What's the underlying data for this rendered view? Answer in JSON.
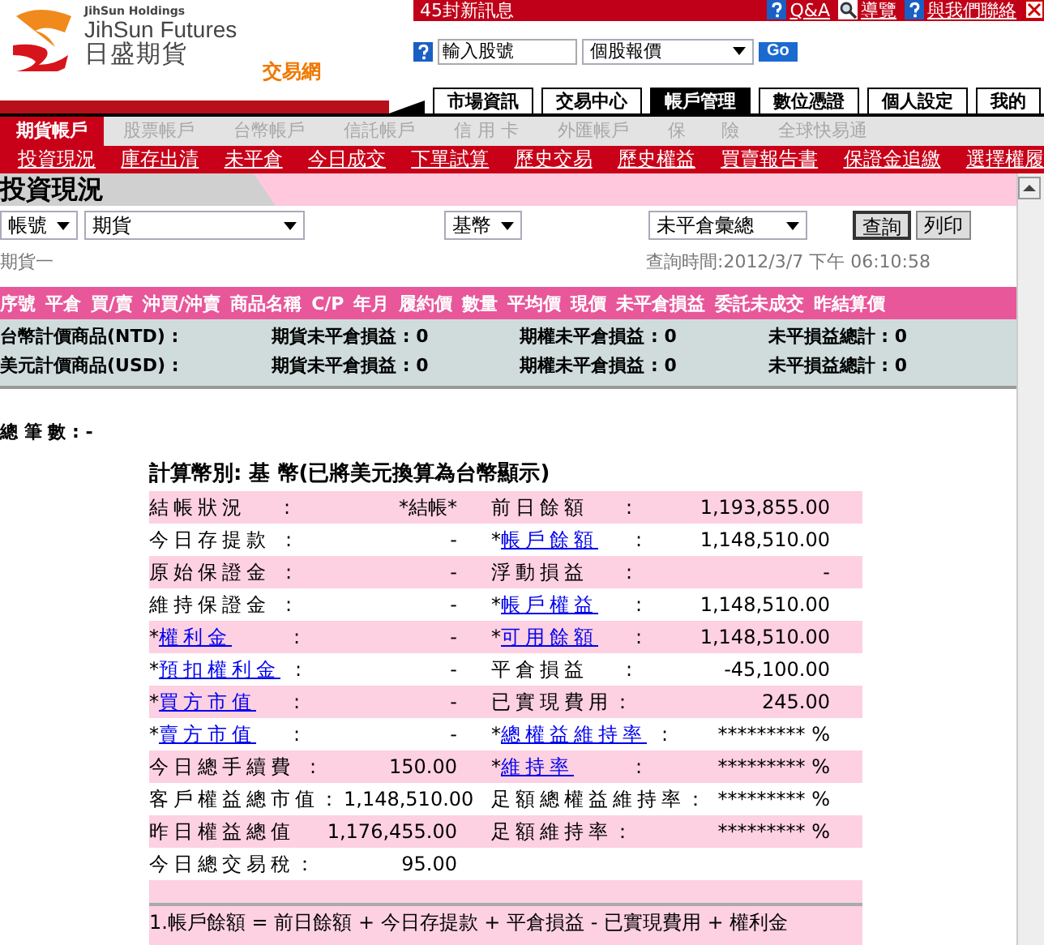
{
  "header": {
    "holding": "JihSun Holdings",
    "brand": "JihSun Futures",
    "brand_cn": "日盛期貨",
    "site": "交易網",
    "messages": "45封新訊息",
    "links": [
      {
        "kind": "help",
        "label": "Q&A"
      },
      {
        "kind": "search",
        "label": "導覽"
      },
      {
        "kind": "help",
        "label": "與我們聯絡"
      }
    ],
    "stock_input": {
      "value": "輸入股號"
    },
    "quote_select": {
      "value": "個股報價"
    },
    "go": "Go"
  },
  "main_tabs": [
    {
      "label": "市場資訊",
      "selected": false
    },
    {
      "label": "交易中心",
      "selected": false
    },
    {
      "label": "帳戶管理",
      "selected": true
    },
    {
      "label": "數位憑證",
      "selected": false
    },
    {
      "label": "個人設定",
      "selected": false
    },
    {
      "label": "我的",
      "selected": false
    }
  ],
  "account_tabs": [
    {
      "label": "期貨帳戶",
      "selected": true
    },
    {
      "label": "股票帳戶",
      "selected": false
    },
    {
      "label": "台幣帳戶",
      "selected": false
    },
    {
      "label": "信託帳戶",
      "selected": false
    },
    {
      "label": "信 用 卡",
      "selected": false
    },
    {
      "label": "外匯帳戶",
      "selected": false
    },
    {
      "label": "保　　險",
      "selected": false
    },
    {
      "label": "全球快易通",
      "selected": false
    }
  ],
  "sub_nav": [
    "投資現況",
    "庫存出清",
    "未平倉",
    "今日成交",
    "下單試算",
    "歷史交易",
    "歷史權益",
    "買賣報告書",
    "保證金追繳",
    "選擇權履"
  ],
  "page_title": "投資現況",
  "filters": {
    "selects": [
      "帳號",
      "期貨",
      "基幣",
      "未平倉彙總"
    ],
    "buttons": [
      {
        "label": "查詢",
        "selected": true
      },
      {
        "label": "列印",
        "selected": false
      }
    ]
  },
  "account_name": "期貨一",
  "query_time": "查詢時間:2012/3/7 下午 06:10:58",
  "table": {
    "columns": [
      "序號",
      "平倉",
      "買/賣",
      "沖買/沖賣",
      "商品名稱",
      "C/P",
      "年月",
      "履約價",
      "數量",
      "平均價",
      "現價",
      "未平倉損益",
      "委託未成交",
      "昨結算價"
    ],
    "totals": [
      {
        "currency": "台幣計價商品(NTD) :",
        "items": [
          "期貨未平倉損益 : 0",
          "期權未平倉損益 : 0",
          "未平損益總計 : 0"
        ]
      },
      {
        "currency": "美元計價商品(USD) :",
        "items": [
          "期貨未平倉損益 : 0",
          "期權未平倉損益 : 0",
          "未平損益總計 : 0"
        ]
      }
    ]
  },
  "count": "總 筆 數 : -",
  "summary": {
    "title": "計算幣別: 基 幣(已將美元換算為台幣顯示)",
    "rows": [
      {
        "left": {
          "label": "結帳狀況",
          "colon": ":",
          "value": "*結帳*"
        },
        "right": {
          "label": "前日餘額",
          "colon": ":",
          "value": "1,193,855.00"
        }
      },
      {
        "left": {
          "label": "今日存提款",
          "colon": ":",
          "value": "-"
        },
        "right": {
          "prefix": "*",
          "label": "帳戶餘額",
          "link": true,
          "colon": ":",
          "value": "1,148,510.00"
        }
      },
      {
        "left": {
          "label": "原始保證金",
          "colon": ":",
          "value": "-"
        },
        "right": {
          "label": "浮動損益",
          "colon": ":",
          "value": "-"
        }
      },
      {
        "left": {
          "label": "維持保證金",
          "colon": ":",
          "value": "-"
        },
        "right": {
          "prefix": "*",
          "label": "帳戶權益",
          "link": true,
          "colon": ":",
          "value": "1,148,510.00"
        }
      },
      {
        "left": {
          "prefix": "*",
          "label": "權利金",
          "link": true,
          "colon": ":",
          "value": "-"
        },
        "right": {
          "prefix": "*",
          "label": "可用餘額",
          "link": true,
          "colon": ":",
          "value": "1,148,510.00"
        }
      },
      {
        "left": {
          "prefix": "*",
          "label": "預扣權利金",
          "link": true,
          "colon": ":",
          "value": "-"
        },
        "right": {
          "label": "平倉損益",
          "colon": ":",
          "value": "-45,100.00"
        }
      },
      {
        "left": {
          "prefix": "*",
          "label": "買方市值",
          "link": true,
          "colon": ":",
          "value": "-"
        },
        "right": {
          "label": "已實現費用：",
          "value": "245.00"
        }
      },
      {
        "left": {
          "prefix": "*",
          "label": "賣方市值",
          "link": true,
          "colon": ":",
          "value": "-"
        },
        "right": {
          "prefix": "*",
          "label": "總權益維持率",
          "link": true,
          "colon": ":",
          "value": "********* %"
        }
      },
      {
        "left": {
          "label": "今日總手續費",
          "colon": ":",
          "value": "150.00"
        },
        "right": {
          "prefix": "*",
          "label": "維持率",
          "link": true,
          "colon": ":",
          "value": "********* %"
        }
      },
      {
        "left": {
          "label": "客戶權益總市值：",
          "value": "1,148,510.00"
        },
        "right": {
          "label": "足額總權益維持率：",
          "value": "********* %"
        }
      },
      {
        "left": {
          "label": "昨日權益總值",
          "value": "1,176,455.00"
        },
        "right": {
          "label": "足額維持率：",
          "value": "********* %"
        }
      },
      {
        "left": {
          "label": "今日總交易稅：",
          "value": "95.00"
        }
      }
    ],
    "notes": [
      "1.帳戶餘額 = 前日餘額 + 今日存提款 + 平倉損益 - 已實現費用 + 權利金"
    ]
  }
}
